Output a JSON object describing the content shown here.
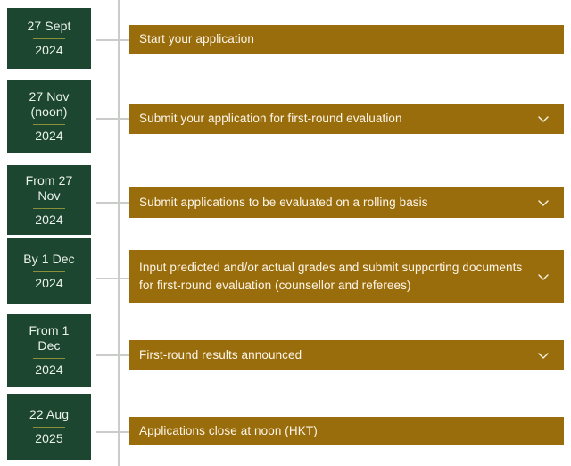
{
  "colors": {
    "page_background": "#ffffff",
    "date_card_background": "#1d4630",
    "date_card_text": "#eaf2ec",
    "date_card_rule": "#8a8f3a",
    "task_bar_background": "#9a6d0c",
    "task_bar_text": "#fdf6ea",
    "connector_line": "#c9ccc9"
  },
  "timeline": {
    "items": [
      {
        "date": "27 Sept",
        "year": "2024",
        "task": "Start your application",
        "expand_icon": "",
        "has_expand": false
      },
      {
        "date": "27 Nov\n(noon)",
        "date_line1": "27 Nov",
        "date_line2": "(noon)",
        "year": "2024",
        "task": "Submit your application for first-round evaluation",
        "expand_icon": "chevron-down-icon",
        "has_expand": true
      },
      {
        "date": "From 27 Nov",
        "date_line1": "From 27",
        "date_line2": "Nov",
        "year": "2024",
        "task": "Submit applications to be evaluated on a rolling basis",
        "expand_icon": "chevron-down-icon",
        "has_expand": true
      },
      {
        "date": "By 1 Dec",
        "date_line1": "By 1 Dec",
        "date_line2": "",
        "year": "2024",
        "task": "Input predicted and/or actual grades and submit supporting documents for first-round evaluation (counsellor and referees)",
        "expand_icon": "chevron-down-icon",
        "has_expand": true
      },
      {
        "date": "From 1 Dec",
        "date_line1": "From 1",
        "date_line2": "Dec",
        "year": "2024",
        "task": "First-round results announced",
        "expand_icon": "chevron-down-icon",
        "has_expand": true
      },
      {
        "date": "22 Aug",
        "date_line1": "22 Aug",
        "date_line2": "",
        "year": "2025",
        "task": "Applications close at noon (HKT)",
        "expand_icon": "",
        "has_expand": false
      }
    ]
  }
}
